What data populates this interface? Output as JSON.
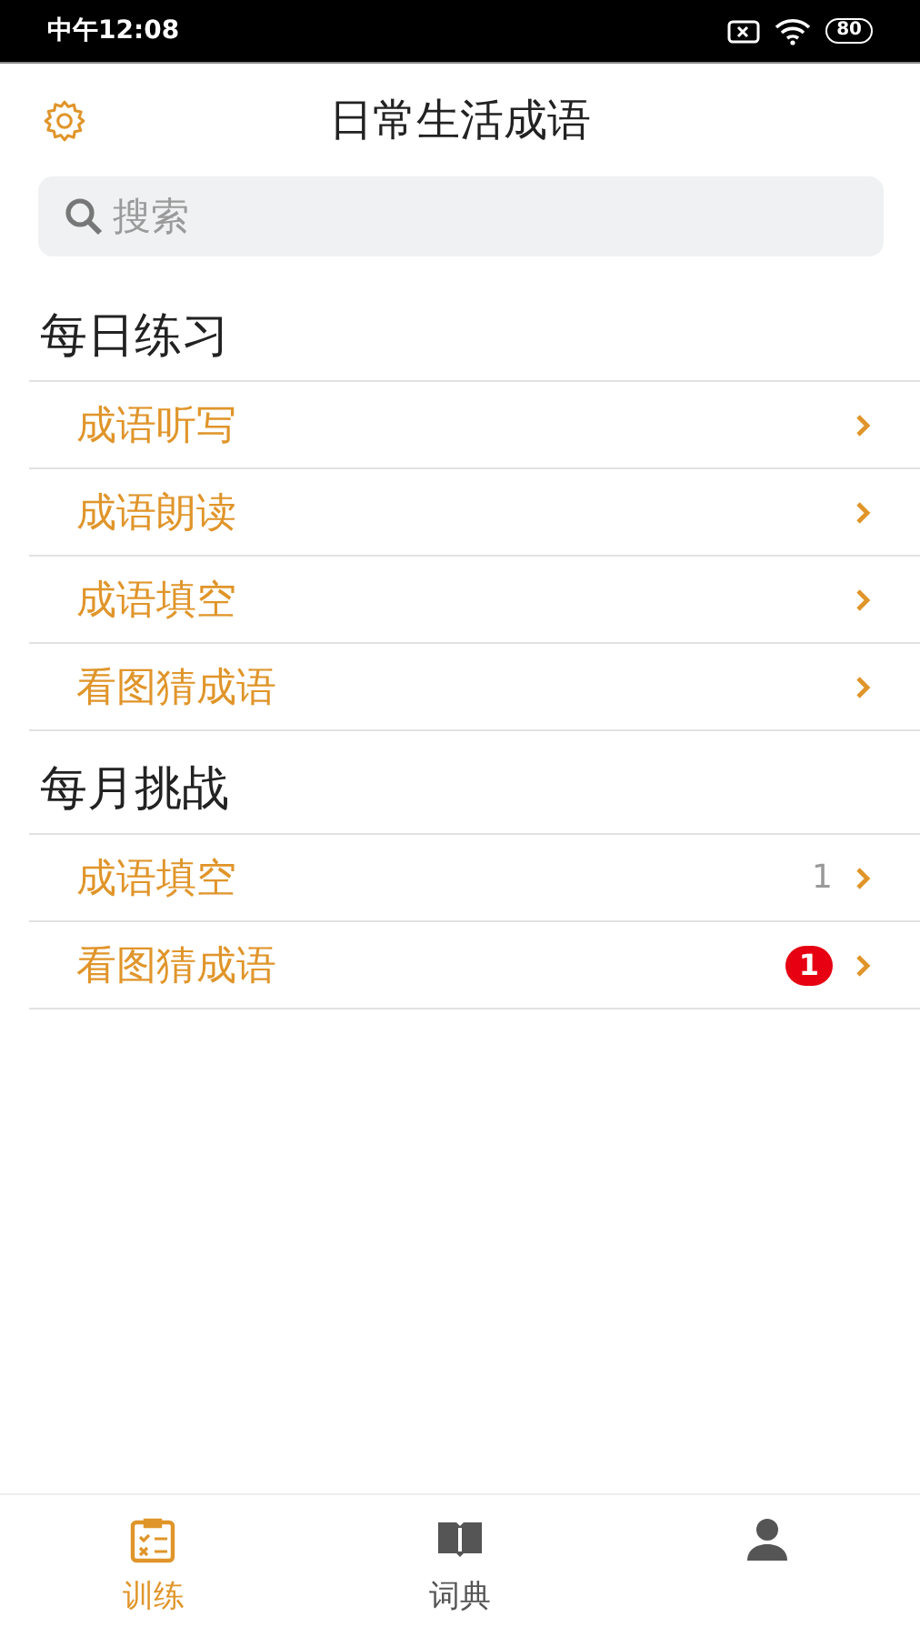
{
  "status_bar": {
    "time": "中午12:08",
    "battery": "80"
  },
  "header": {
    "title": "日常生活成语"
  },
  "search": {
    "placeholder": "搜索"
  },
  "sections": [
    {
      "title": "每日练习",
      "items": [
        {
          "label": "成语听写"
        },
        {
          "label": "成语朗读"
        },
        {
          "label": "成语填空"
        },
        {
          "label": "看图猜成语"
        }
      ]
    },
    {
      "title": "每月挑战",
      "items": [
        {
          "label": "成语填空",
          "count": "1"
        },
        {
          "label": "看图猜成语",
          "badge": "1"
        }
      ]
    }
  ],
  "tabs": [
    {
      "label": "训练",
      "kind": "clipboard",
      "selected": true
    },
    {
      "label": "词典",
      "kind": "book",
      "selected": false
    },
    {
      "kind": "person",
      "selected": false
    }
  ]
}
